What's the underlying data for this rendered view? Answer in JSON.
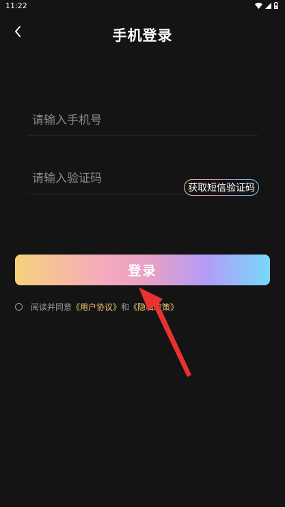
{
  "status_bar": {
    "time": "11:22"
  },
  "header": {
    "back_icon": "chevron-left-icon",
    "title": "手机登录"
  },
  "form": {
    "phone_placeholder": "请输入手机号",
    "code_placeholder": "请输入验证码",
    "get_code_label": "获取短信验证码",
    "login_label": "登录"
  },
  "agreement": {
    "prefix": "阅读并同意",
    "user_agreement": "《用户协议》",
    "and": "和",
    "privacy_policy": "《隐私政策》"
  },
  "colors": {
    "background": "#141414",
    "gradient": [
      "#f6d27b",
      "#f6a9bd",
      "#b39cf8",
      "#77d9f9"
    ],
    "link": "#f4c66b",
    "annotation_arrow": "#e8322f"
  }
}
